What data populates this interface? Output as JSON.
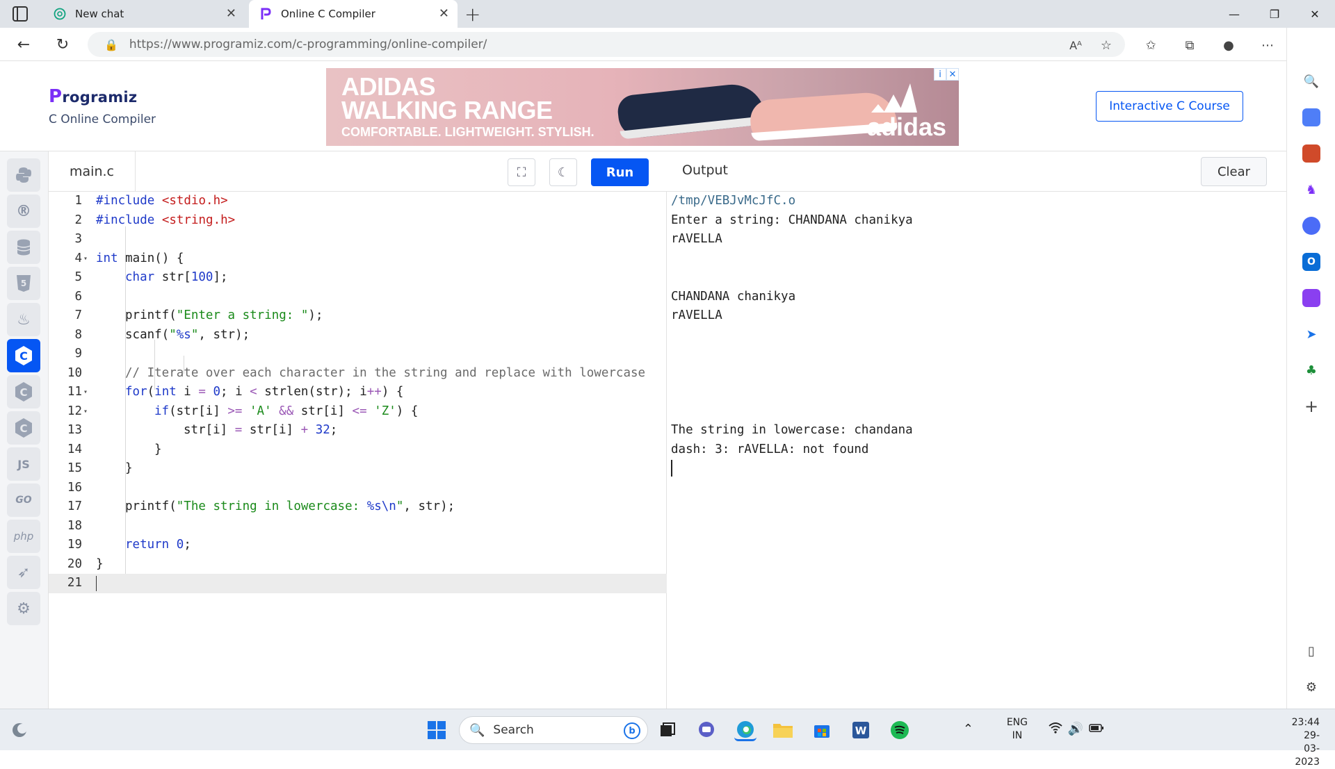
{
  "browser": {
    "tabs": [
      {
        "title": "New chat",
        "icon": "chatgpt-icon"
      },
      {
        "title": "Online C Compiler",
        "icon": "programiz-icon",
        "active": true
      }
    ],
    "url_domain": "https://www.programiz.com",
    "url_path": "/c-programming/online-compiler/",
    "read_aloud_label": "Aᴬ"
  },
  "header": {
    "logo": "rogramiz",
    "logo_initial": "P",
    "subtitle": "C Online Compiler",
    "course_button": "Interactive C Course"
  },
  "ad": {
    "headline_1": "ADIDAS",
    "headline_2": "WALKING RANGE",
    "tagline": "COMFORTABLE. LIGHTWEIGHT. STYLISH.",
    "brand": "adidas",
    "info_icon": "i",
    "close_icon": "✕"
  },
  "languages": [
    "python",
    "r",
    "sql",
    "html",
    "java",
    "c",
    "c#",
    "c++",
    "JS",
    "GO",
    "php",
    "swift",
    "rust"
  ],
  "editor": {
    "filename": "main.c",
    "run_label": "Run",
    "lines": [
      {
        "n": "1"
      },
      {
        "n": "2"
      },
      {
        "n": "3"
      },
      {
        "n": "4"
      },
      {
        "n": "5"
      },
      {
        "n": "6"
      },
      {
        "n": "7"
      },
      {
        "n": "8"
      },
      {
        "n": "9"
      },
      {
        "n": "10"
      },
      {
        "n": "11"
      },
      {
        "n": "12"
      },
      {
        "n": "13"
      },
      {
        "n": "14"
      },
      {
        "n": "15"
      },
      {
        "n": "16"
      },
      {
        "n": "17"
      },
      {
        "n": "18"
      },
      {
        "n": "19"
      },
      {
        "n": "20"
      },
      {
        "n": "21"
      }
    ],
    "code": {
      "l1_a": "#include ",
      "l1_b": "<stdio.h>",
      "l2_a": "#include ",
      "l2_b": "<string.h>",
      "l4_a": "int",
      "l4_b": " main() {",
      "l5_a": "char",
      "l5_b": " str[",
      "l5_c": "100",
      "l5_d": "];",
      "l7_a": "printf(",
      "l7_b": "\"Enter a string: \"",
      "l7_c": ");",
      "l8_a": "scanf(",
      "l8_b": "\"",
      "l8_c": "%s",
      "l8_d": "\"",
      "l8_e": ", str);",
      "l10": "// Iterate over each character in the string and replace with lowercase",
      "l11_a": "for",
      "l11_b": "(",
      "l11_c": "int",
      "l11_d": " i ",
      "l11_e": "=",
      "l11_f": " ",
      "l11_g": "0",
      "l11_h": "; i ",
      "l11_i": "<",
      "l11_j": " strlen(str); i",
      "l11_k": "++",
      "l11_l": ") {",
      "l12_a": "if",
      "l12_b": "(str[i] ",
      "l12_c": ">=",
      "l12_d": " ",
      "l12_e": "'A'",
      "l12_f": " ",
      "l12_g": "&&",
      "l12_h": " str[i] ",
      "l12_i": "<=",
      "l12_j": " ",
      "l12_k": "'Z'",
      "l12_l": ") {",
      "l13_a": "str[i] ",
      "l13_b": "=",
      "l13_c": " str[i] ",
      "l13_d": "+",
      "l13_e": " ",
      "l13_f": "32",
      "l13_g": ";",
      "l14": "}",
      "l15": "}",
      "l17_a": "printf(",
      "l17_b": "\"The string in lowercase: ",
      "l17_c": "%s\\n",
      "l17_d": "\"",
      "l17_e": ", str);",
      "l19_a": "return",
      "l19_b": " ",
      "l19_c": "0",
      "l19_d": ";",
      "l20": "}"
    }
  },
  "output": {
    "title": "Output",
    "clear_label": "Clear",
    "lines": [
      "/tmp/VEBJvMcJfC.o",
      "Enter a string: CHANDANA chanikya",
      "rAVELLA",
      "CHANDANA chanikya",
      "rAVELLA",
      "The string in lowercase: chandana",
      "dash: 3: rAVELLA: not found"
    ]
  },
  "taskbar": {
    "search_placeholder": "Search",
    "bing_label": "b",
    "lang_top": "ENG",
    "lang_bottom": "IN",
    "time": "23:44",
    "date": "29-03-2023"
  },
  "colors": {
    "accent": "#0556f3",
    "keyword": "#1f3ac9",
    "string": "#1a8a1a",
    "include": "#c41d1d"
  }
}
